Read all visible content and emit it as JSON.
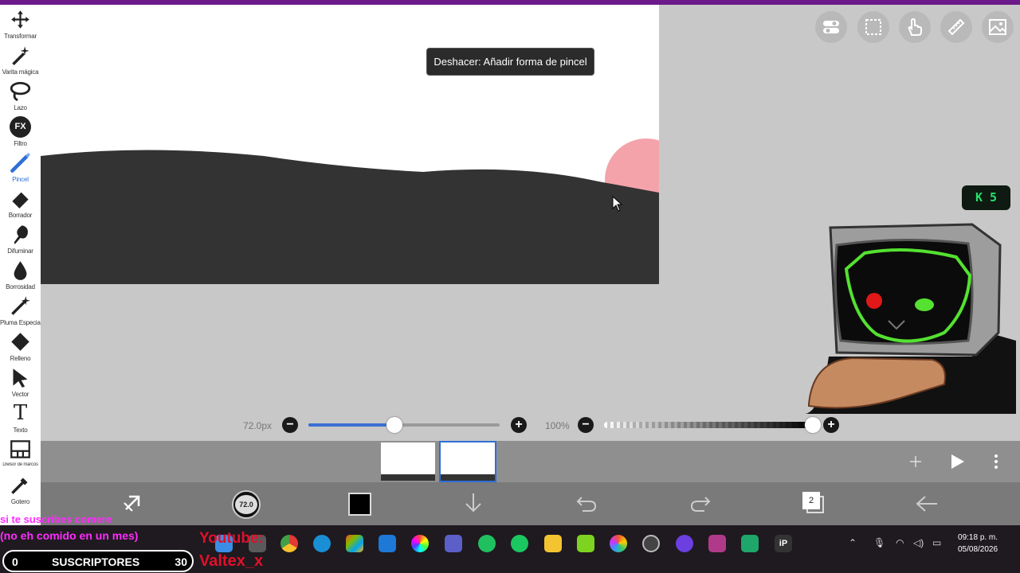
{
  "toolbar": {
    "tools": [
      {
        "label": "Transformar",
        "icon": "move-icon"
      },
      {
        "label": "Varita mágica",
        "icon": "magic-wand-icon"
      },
      {
        "label": "Lazo",
        "icon": "lasso-icon"
      },
      {
        "label": "Filtro",
        "icon": "fx-icon",
        "glyph": "FX"
      },
      {
        "label": "Pincel",
        "icon": "brush-icon",
        "active": true
      },
      {
        "label": "Borrador",
        "icon": "eraser-icon"
      },
      {
        "label": "Difuminar",
        "icon": "smudge-icon"
      },
      {
        "label": "Borrosidad",
        "icon": "blur-drop-icon"
      },
      {
        "label": "Pluma Especial",
        "icon": "special-pen-icon"
      },
      {
        "label": "Relleno",
        "icon": "fill-icon"
      },
      {
        "label": "Vector",
        "icon": "vector-cursor-icon"
      },
      {
        "label": "Texto",
        "icon": "text-icon",
        "glyph": "T"
      },
      {
        "label": "Divisor de marcos",
        "icon": "frame-divider-icon"
      },
      {
        "label": "Gotero",
        "icon": "eyedropper-icon"
      }
    ]
  },
  "tooltip": "Deshacer: Añadir forma de pincel",
  "badge": {
    "glyph": "K",
    "value": "5"
  },
  "brush_size": {
    "label": "72.0px",
    "fraction": 0.45
  },
  "opacity": {
    "label": "100%",
    "fraction": 1.0
  },
  "brush_preview_label": "72.0",
  "layers_count": "2",
  "colors": {
    "primary": "#000000",
    "accent": "#2e6fd6",
    "top_accent": "#6c1a8a"
  },
  "overlay": {
    "line1": "si te suscribes comere",
    "line2": "(no eh comido en un mes)",
    "youtube_label": "Youtube:",
    "handle": "Valtex_x",
    "sub_current": "0",
    "sub_label": "SUSCRIPTORES",
    "sub_goal": "30"
  },
  "clock": {
    "time": "09:18 p. m.",
    "date": "05/08/2026"
  }
}
